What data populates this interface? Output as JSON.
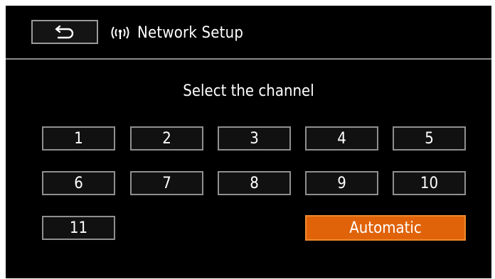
{
  "header": {
    "back_icon": "return-arrow-icon",
    "wifi_icon": "wifi-antenna-icon",
    "wifi_glyph": "(ψ)",
    "title": "Network Setup"
  },
  "main": {
    "prompt": "Select the channel",
    "channels": [
      "1",
      "2",
      "3",
      "4",
      "5",
      "6",
      "7",
      "8",
      "9",
      "10",
      "11"
    ],
    "automatic_label": "Automatic",
    "selected": "Automatic"
  },
  "colors": {
    "background": "#000000",
    "button_border": "#8f8f8f",
    "selected_accent": "#e0630a"
  }
}
